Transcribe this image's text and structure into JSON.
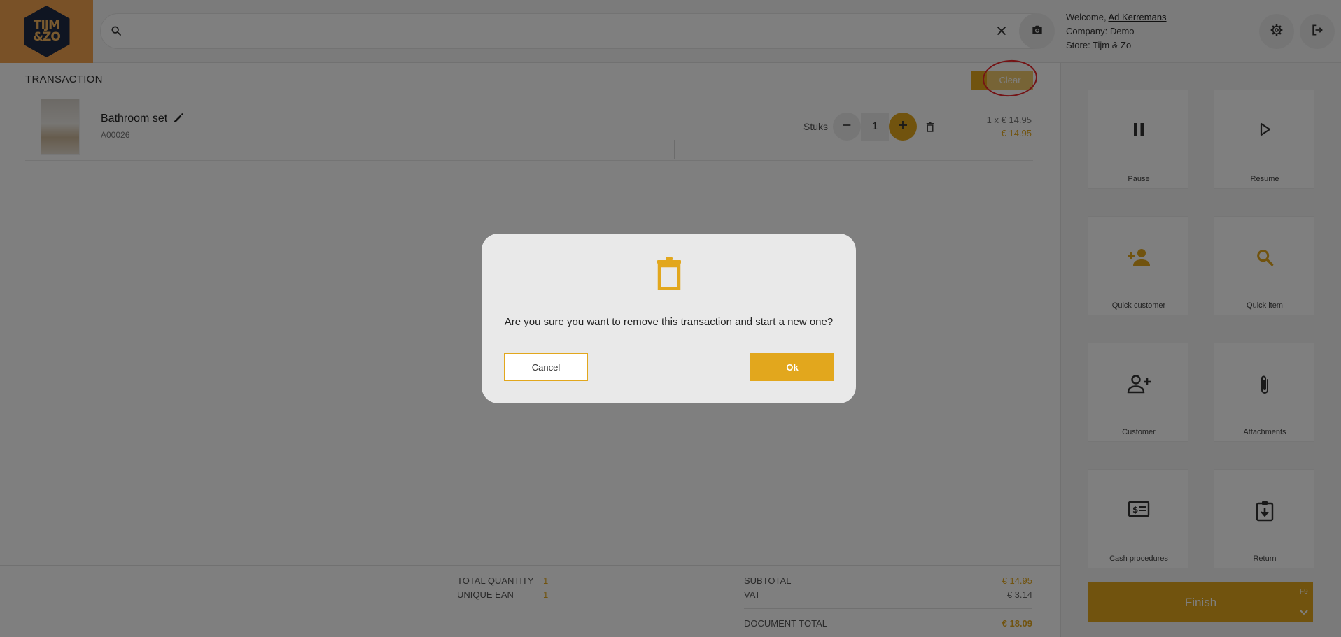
{
  "header": {
    "logo_text": "TIJM &ZO",
    "search_placeholder": "",
    "welcome_prefix": "Welcome, ",
    "user_name": "Ad Kerremans",
    "company": "Company: Demo",
    "store": "Store: Tijm & Zo"
  },
  "transaction": {
    "title": "TRANSACTION",
    "clear_label": "Clear",
    "items": [
      {
        "name": "Bathroom set",
        "sku": "A00026",
        "unit": "Stuks",
        "quantity": "1",
        "price_line": "1 x € 14.95",
        "total": "€ 14.95"
      }
    ]
  },
  "summary": {
    "total_quantity_label": "TOTAL QUANTITY",
    "total_quantity": "1",
    "unique_ean_label": "UNIQUE EAN",
    "unique_ean": "1",
    "subtotal_label": "SUBTOTAL",
    "subtotal": "€ 14.95",
    "vat_label": "VAT",
    "vat": "€ 3.14",
    "document_total_label": "DOCUMENT TOTAL",
    "document_total": "€ 18.09"
  },
  "actions": [
    {
      "label": "Pause",
      "icon": "pause-icon"
    },
    {
      "label": "Resume",
      "icon": "play-icon"
    },
    {
      "label": "Quick customer",
      "icon": "person-add-icon"
    },
    {
      "label": "Quick item",
      "icon": "search-icon"
    },
    {
      "label": "Customer",
      "icon": "person-add-outline-icon"
    },
    {
      "label": "Attachments",
      "icon": "paperclip-icon"
    },
    {
      "label": "Cash procedures",
      "icon": "cash-icon"
    },
    {
      "label": "Return",
      "icon": "return-icon"
    }
  ],
  "finish": {
    "label": "Finish",
    "shortcut": "F9"
  },
  "dialog": {
    "message": "Are you sure you want to remove this transaction and start a new one?",
    "cancel_label": "Cancel",
    "ok_label": "Ok"
  },
  "colors": {
    "accent": "#e2a71d",
    "logo_bg": "#f2a24e",
    "annotation": "#e8262b"
  }
}
